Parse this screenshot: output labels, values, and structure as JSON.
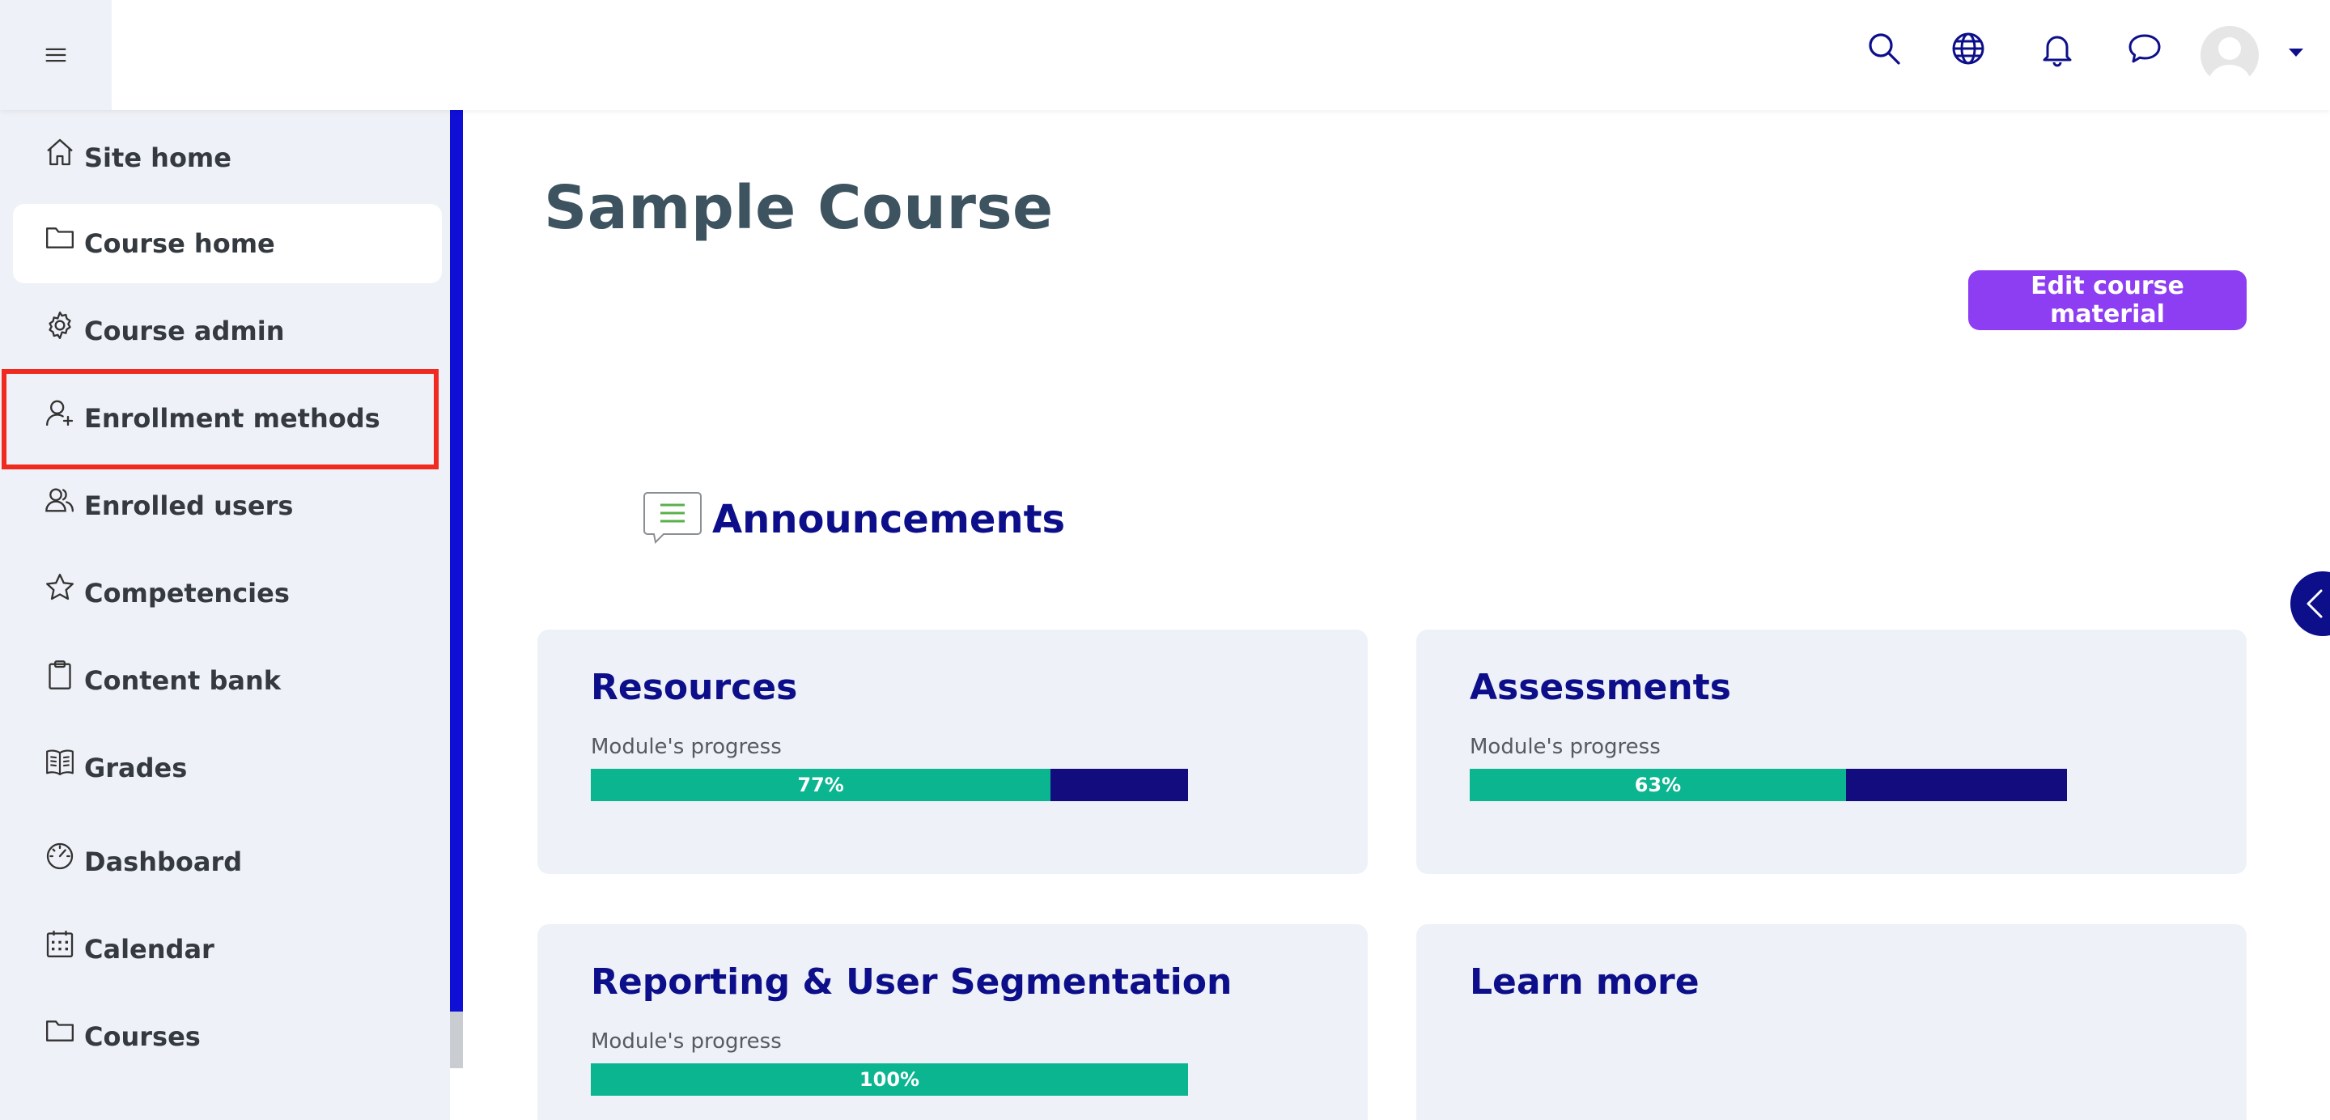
{
  "sidebar": {
    "items": [
      {
        "label": "Site home",
        "icon": "house-icon"
      },
      {
        "label": "Course home",
        "icon": "folder-icon"
      },
      {
        "label": "Course admin",
        "icon": "gear-icon"
      },
      {
        "label": "Enrollment methods",
        "icon": "user-plus-icon"
      },
      {
        "label": "Enrolled users",
        "icon": "users-icon"
      },
      {
        "label": "Competencies",
        "icon": "star-icon"
      },
      {
        "label": "Content bank",
        "icon": "clipboard-icon"
      },
      {
        "label": "Grades",
        "icon": "book-icon"
      },
      {
        "label": "Dashboard",
        "icon": "gauge-icon"
      },
      {
        "label": "Calendar",
        "icon": "calendar-icon"
      },
      {
        "label": "Courses",
        "icon": "folder-icon"
      }
    ]
  },
  "main": {
    "title": "Sample Course",
    "edit_button": "Edit course material",
    "announcements": "Announcements",
    "cards": [
      {
        "title": "Resources",
        "subtitle": "Module's progress",
        "progress": 77,
        "progress_label": "77%"
      },
      {
        "title": "Assessments",
        "subtitle": "Module's progress",
        "progress": 63,
        "progress_label": "63%"
      },
      {
        "title": "Reporting & User Segmentation",
        "subtitle": "Module's progress",
        "progress": 100,
        "progress_label": "100%"
      },
      {
        "title": "Learn more"
      }
    ]
  },
  "colors": {
    "accent": "#8d3df2",
    "navy": "#0d0f8a",
    "progress_fill": "#0bb58f",
    "progress_track": "#120c7e",
    "sidebar_accent": "#0f0fd6",
    "highlight": "#f02a1e"
  }
}
